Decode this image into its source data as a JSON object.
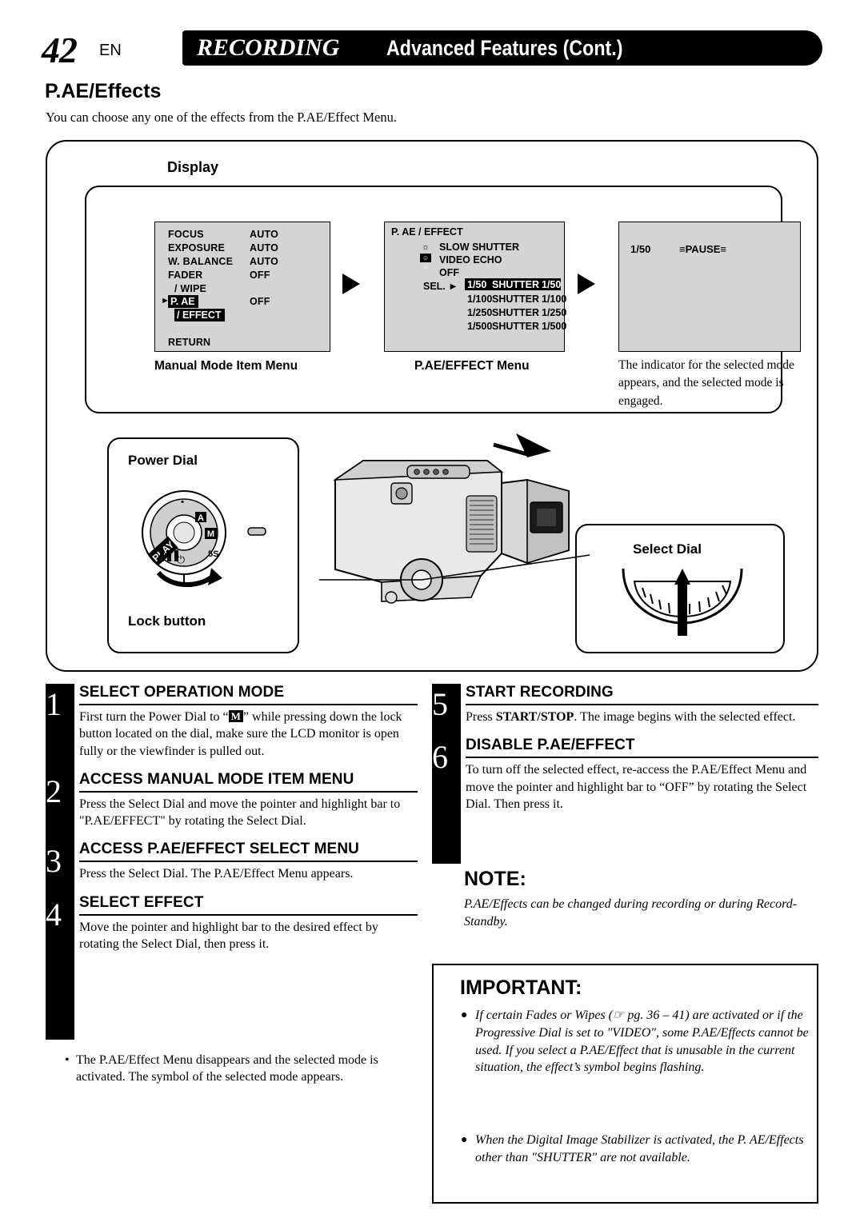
{
  "header": {
    "page_number": "42",
    "page_lang": "EN",
    "title_italic": "RECORDING",
    "title_bold": "Advanced Features (Cont.)"
  },
  "section": {
    "title": "P.AE/Effects",
    "intro": "You can choose any one of the effects from the P.AE/Effect Menu."
  },
  "display_block": {
    "label": "Display",
    "manual_menu": {
      "caption": "Manual Mode Item Menu",
      "rows": [
        {
          "label": "FOCUS",
          "value": "AUTO"
        },
        {
          "label": "EXPOSURE",
          "value": "AUTO"
        },
        {
          "label": "W. BALANCE",
          "value": "AUTO"
        },
        {
          "label": "FADER",
          "value": "OFF"
        },
        {
          "label": "/ WIPE",
          "value": ""
        },
        {
          "label": "P. AE",
          "value": "OFF"
        },
        {
          "label": "/ EFFECT",
          "value": ""
        }
      ],
      "pointer_row": "P. AE",
      "highlight_row": "/ EFFECT",
      "return_label": "RETURN"
    },
    "pae_menu": {
      "caption": "P.AE/EFFECT Menu",
      "title": "P. AE / EFFECT",
      "sel_label": "SEL.",
      "items": [
        {
          "icon": "sun-icon",
          "label": "SLOW SHUTTER",
          "value": ""
        },
        {
          "icon": "echo-icon",
          "label": "VIDEO ECHO",
          "value": ""
        },
        {
          "icon": "",
          "label": "OFF",
          "value": ""
        },
        {
          "icon": "",
          "label": "SHUTTER",
          "value": "1/50",
          "prefix": "1/50",
          "highlighted": true
        },
        {
          "icon": "",
          "label": "SHUTTER",
          "value": "1/100",
          "prefix": "1/100"
        },
        {
          "icon": "",
          "label": "SHUTTER",
          "value": "1/250",
          "prefix": "1/250"
        },
        {
          "icon": "",
          "label": "SHUTTER",
          "value": "1/500",
          "prefix": "1/500"
        }
      ]
    },
    "result_screen": {
      "shutter_value": "1/50",
      "pause_label": "PAUSE",
      "description": "The indicator for the selected mode appears, and the selected mode is engaged."
    }
  },
  "camera_block": {
    "power_dial_label": "Power Dial",
    "lock_button_label": "Lock button",
    "select_dial_label": "Select Dial",
    "dial_positions": [
      "PLAY",
      "A",
      "M",
      "5S",
      "power-icon"
    ]
  },
  "steps": [
    {
      "num": "1",
      "heading": "SELECT OPERATION MODE",
      "body_pre": "First turn the Power Dial to “",
      "body_icon": "M",
      "body_post": "” while pressing down the lock button located on the dial, make sure the LCD monitor is open fully or the viewfinder is pulled out."
    },
    {
      "num": "2",
      "heading": "ACCESS MANUAL MODE ITEM MENU",
      "body": "Press the Select Dial and move the pointer and highlight bar to \"P.AE/EFFECT\" by rotating the Select Dial."
    },
    {
      "num": "3",
      "heading": "ACCESS P.AE/EFFECT SELECT MENU",
      "body": "Press the Select Dial. The P.AE/Effect Menu appears."
    },
    {
      "num": "4",
      "heading": "SELECT EFFECT",
      "body": "Move the pointer and highlight bar to the desired effect by rotating the Select Dial, then press it."
    },
    {
      "num": "5",
      "heading": "START RECORDING",
      "body_pre": "Press ",
      "body_bold": "START/STOP",
      "body_post": ". The image begins with the selected effect."
    },
    {
      "num": "6",
      "heading": "DISABLE P.AE/EFFECT",
      "body": "To turn off the selected effect, re-access the P.AE/Effect Menu and move the pointer and highlight bar to “OFF” by rotating the Select Dial. Then press it."
    }
  ],
  "left_bullet": "The P.AE/Effect Menu disappears and the selected mode is activated. The symbol of the selected mode appears.",
  "note": {
    "heading": "NOTE:",
    "body": "P.AE/Effects can be changed during recording or during Record-Standby."
  },
  "important": {
    "heading": "IMPORTANT:",
    "items": [
      "If certain Fades or Wipes (☞ pg. 36 – 41) are activated or if the Progressive Dial is set to \"VIDEO\", some P.AE/Effects cannot be used. If you select a P.AE/Effect that is unusable in the current situation, the effect’s symbol begins flashing.",
      "When the Digital Image Stabilizer is activated, the P. AE/Effects other than \"SHUTTER\" are not available."
    ]
  },
  "colors": {
    "screen_bg": "#d4d4d4",
    "ink": "#000000"
  }
}
